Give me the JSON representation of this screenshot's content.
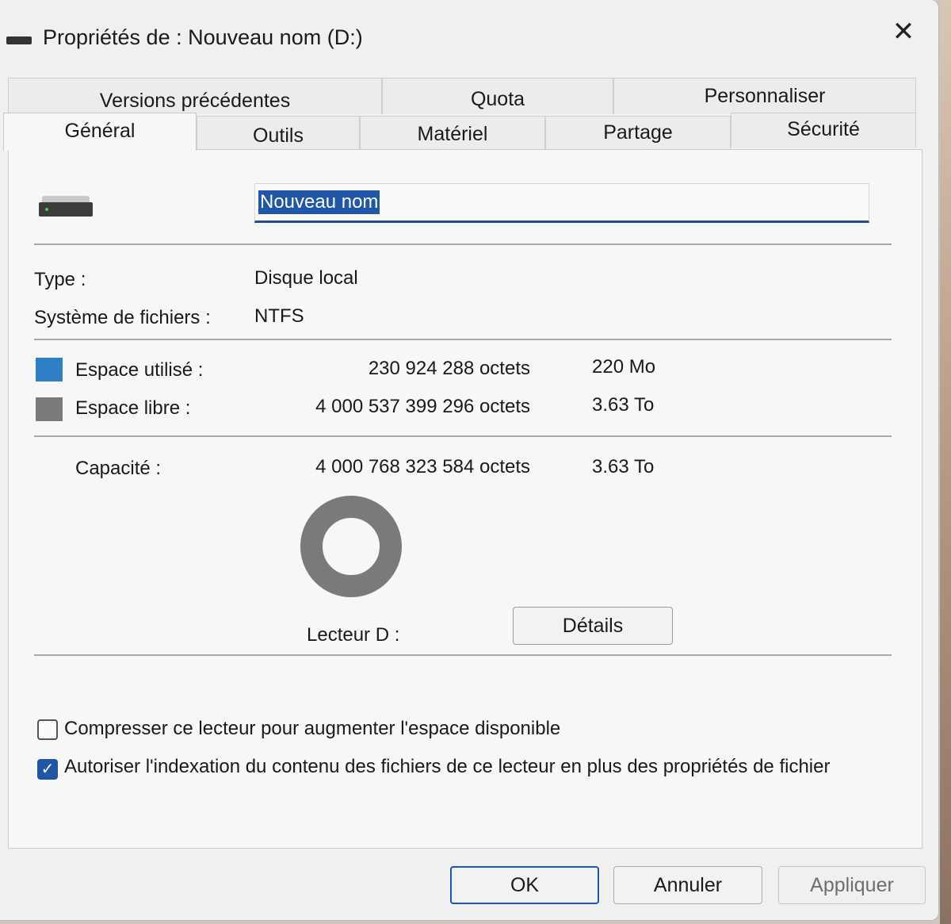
{
  "window": {
    "title": "Propriétés de : Nouveau nom (D:)",
    "close_glyph": "✕"
  },
  "tabs": {
    "row_back": [
      {
        "label": "Versions précédentes"
      },
      {
        "label": "Quota"
      },
      {
        "label": "Personnaliser"
      }
    ],
    "row_front": [
      {
        "label": "Général",
        "active": true
      },
      {
        "label": "Outils"
      },
      {
        "label": "Matériel"
      },
      {
        "label": "Partage"
      },
      {
        "label": "Sécurité"
      }
    ]
  },
  "general": {
    "name_value": "Nouveau nom",
    "type_label": "Type :",
    "type_value": "Disque local",
    "fs_label": "Système de fichiers :",
    "fs_value": "NTFS",
    "used": {
      "label": "Espace utilisé :",
      "bytes": "230 924 288 octets",
      "size": "220 Mo",
      "color": "#2f7fc6"
    },
    "free": {
      "label": "Espace libre :",
      "bytes": "4 000 537 399 296 octets",
      "size": "3.63 To",
      "color": "#7a7a7a"
    },
    "capacity": {
      "label": "Capacité :",
      "bytes": "4 000 768 323 584 octets",
      "size": "3.63 To"
    },
    "drive_label": "Lecteur D :",
    "details_button": "Détails",
    "used_fraction": 5.77e-05,
    "compress": {
      "label": "Compresser ce lecteur pour augmenter l'espace disponible",
      "checked": false
    },
    "index": {
      "label": "Autoriser l'indexation du contenu des fichiers de ce lecteur en plus des propriétés de fichier",
      "checked": true,
      "check_glyph": "✓"
    }
  },
  "footer": {
    "ok": "OK",
    "cancel": "Annuler",
    "apply": "Appliquer"
  }
}
